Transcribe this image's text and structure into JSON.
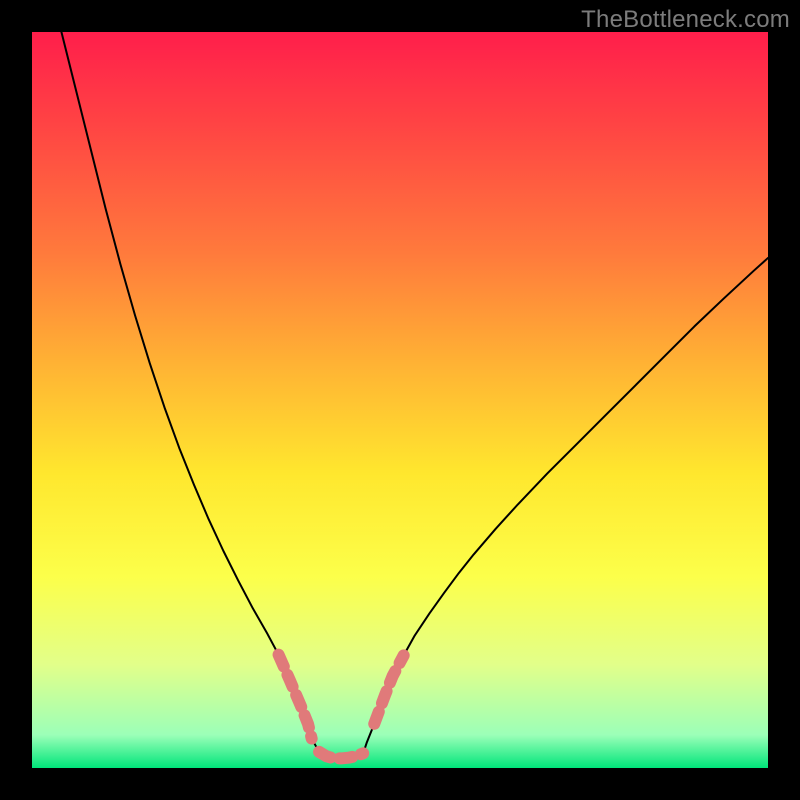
{
  "watermark": "TheBottleneck.com",
  "chart_data": {
    "type": "line",
    "title": "",
    "xlabel": "",
    "ylabel": "",
    "xlim": [
      0,
      100
    ],
    "ylim": [
      0,
      100
    ],
    "grid": false,
    "background": "rainbow-gradient",
    "gradient_stops": [
      {
        "offset": 0.0,
        "color": "#ff1e4b"
      },
      {
        "offset": 0.12,
        "color": "#ff4244"
      },
      {
        "offset": 0.3,
        "color": "#ff7a3c"
      },
      {
        "offset": 0.45,
        "color": "#ffb234"
      },
      {
        "offset": 0.6,
        "color": "#ffe72e"
      },
      {
        "offset": 0.74,
        "color": "#fcff4a"
      },
      {
        "offset": 0.86,
        "color": "#e2ff8a"
      },
      {
        "offset": 0.955,
        "color": "#9cffb8"
      },
      {
        "offset": 1.0,
        "color": "#00e57a"
      }
    ],
    "series": [
      {
        "name": "bottleneck-curve",
        "stroke": "#000000",
        "stroke_width": 2.0,
        "points_xy": [
          [
            4,
            100
          ],
          [
            6,
            92
          ],
          [
            8,
            84
          ],
          [
            10,
            76
          ],
          [
            12,
            68.5
          ],
          [
            14,
            61.5
          ],
          [
            16,
            55
          ],
          [
            18,
            49
          ],
          [
            20,
            43.5
          ],
          [
            22,
            38.5
          ],
          [
            24,
            33.8
          ],
          [
            26,
            29.5
          ],
          [
            28,
            25.5
          ],
          [
            30,
            21.7
          ],
          [
            32,
            18.2
          ],
          [
            33.5,
            15.4
          ],
          [
            35,
            12
          ],
          [
            36.5,
            8.5
          ],
          [
            37.5,
            6
          ],
          [
            38,
            4
          ],
          [
            39,
            2.2
          ],
          [
            40,
            1.6
          ],
          [
            41,
            1.3
          ],
          [
            42,
            1.3
          ],
          [
            43,
            1.4
          ],
          [
            44,
            1.6
          ],
          [
            45,
            2.0
          ],
          [
            45.5,
            3.5
          ],
          [
            46.5,
            6
          ],
          [
            48,
            10
          ],
          [
            49,
            12.5
          ],
          [
            50.5,
            15.3
          ],
          [
            52,
            18
          ],
          [
            54,
            21
          ],
          [
            56,
            23.8
          ],
          [
            58,
            26.5
          ],
          [
            60,
            29
          ],
          [
            63,
            32.5
          ],
          [
            66,
            35.8
          ],
          [
            70,
            40
          ],
          [
            74,
            44
          ],
          [
            78,
            48
          ],
          [
            82,
            52
          ],
          [
            86,
            56
          ],
          [
            90,
            60
          ],
          [
            94,
            63.8
          ],
          [
            98,
            67.5
          ],
          [
            100,
            69.3
          ]
        ]
      },
      {
        "name": "highlight-left-descent",
        "stroke": "#e07a7a",
        "stroke_width": 12,
        "points_xy": [
          [
            33.5,
            15.4
          ],
          [
            35,
            12
          ],
          [
            36.5,
            8.5
          ],
          [
            37.5,
            6
          ],
          [
            38,
            4
          ]
        ]
      },
      {
        "name": "highlight-valley-floor",
        "stroke": "#e07a7a",
        "stroke_width": 12,
        "points_xy": [
          [
            39,
            2.2
          ],
          [
            40,
            1.6
          ],
          [
            41,
            1.3
          ],
          [
            42,
            1.3
          ],
          [
            43,
            1.4
          ],
          [
            44,
            1.6
          ],
          [
            45,
            2.0
          ]
        ]
      },
      {
        "name": "highlight-right-ascent",
        "stroke": "#e07a7a",
        "stroke_width": 12,
        "points_xy": [
          [
            46.5,
            6
          ],
          [
            48,
            10
          ],
          [
            49,
            12.5
          ],
          [
            50.5,
            15.3
          ]
        ]
      }
    ]
  }
}
